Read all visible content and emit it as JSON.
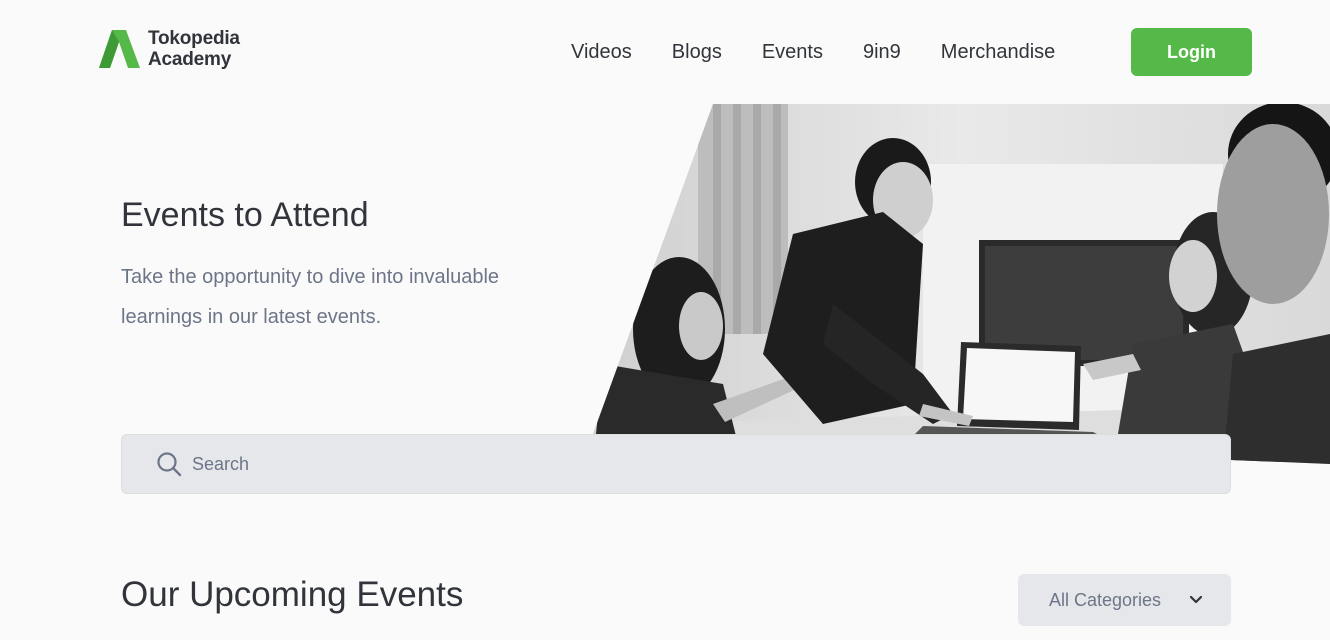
{
  "brand": {
    "line1": "Tokopedia",
    "line2": "Academy",
    "logo_icon": "tokopedia-academy-logo",
    "accent_color": "#54b948"
  },
  "nav": {
    "items": [
      "Videos",
      "Blogs",
      "Events",
      "9in9",
      "Merchandise"
    ],
    "login_label": "Login"
  },
  "hero": {
    "title": "Events to Attend",
    "subtitle": "Take the opportunity to dive into invaluable learnings in our latest events."
  },
  "search": {
    "icon": "search-icon",
    "placeholder": "Search",
    "value": ""
  },
  "upcoming": {
    "title": "Our Upcoming Events",
    "category_selected": "All Categories",
    "category_icon": "chevron-down-icon"
  }
}
